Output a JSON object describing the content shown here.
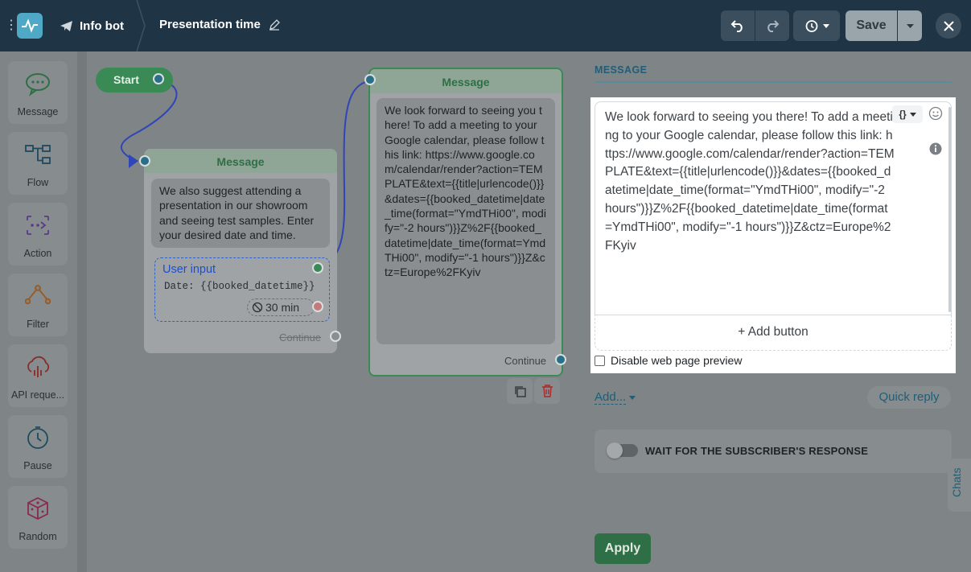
{
  "topbar": {
    "bot_name": "Info bot",
    "flow_title": "Presentation time",
    "save_label": "Save"
  },
  "palette": {
    "items": [
      {
        "label": "Message",
        "icon": "chat-bubble-icon"
      },
      {
        "label": "Flow",
        "icon": "flow-icon"
      },
      {
        "label": "Action",
        "icon": "action-icon"
      },
      {
        "label": "Filter",
        "icon": "filter-icon"
      },
      {
        "label": "API reque...",
        "icon": "api-cloud-icon"
      },
      {
        "label": "Pause",
        "icon": "clock-icon"
      },
      {
        "label": "Random",
        "icon": "dice-icon"
      }
    ]
  },
  "canvas": {
    "start_label": "Start",
    "node1": {
      "header": "Message",
      "text": "We also suggest attending a presentation in our showroom and seeing test samples. Enter your desired date and time.",
      "user_input_title": "User input",
      "user_input_field": "Date: {{booked_datetime}}",
      "timeout": "30 min",
      "continue_label": "Continue"
    },
    "node2": {
      "header": "Message",
      "text": "We look forward to seeing you there! To add a meeting to your Google calendar, please follow this link: https://www.google.com/calendar/render?action=TEMPLATE&text={{title|urlencode()}}&dates={{booked_datetime|date_time(format=\"YmdTHi00\", modify=\"-2 hours\")}}Z%2F{{booked_datetime|date_time(format=YmdTHi00\", modify=\"-1 hours\")}}Z&ctz=Europe%2FKyiv",
      "continue_label": "Continue"
    }
  },
  "panel": {
    "section_label": "MESSAGE",
    "editor_text": "We look forward to seeing you there! To add a meeting to your Google calendar, please follow this link: https://www.google.com/calendar/render?action=TEMPLATE&text={{title|urlencode()}}&dates={{booked_datetime|date_time(format=\"YmdTHi00\", modify=\"-2 hours\")}}Z%2F{{booked_datetime|date_time(format=YmdTHi00\", modify=\"-1 hours\")}}Z&ctz=Europe%2FKyiv",
    "var_button": "{}",
    "add_button": "+ Add button",
    "disable_preview": "Disable web page preview",
    "add_link": "Add...",
    "quick_reply": "Quick reply",
    "wait_label": "WAIT FOR THE SUBSCRIBER'S RESPONSE",
    "chats_tab": "Chats",
    "apply": "Apply"
  }
}
